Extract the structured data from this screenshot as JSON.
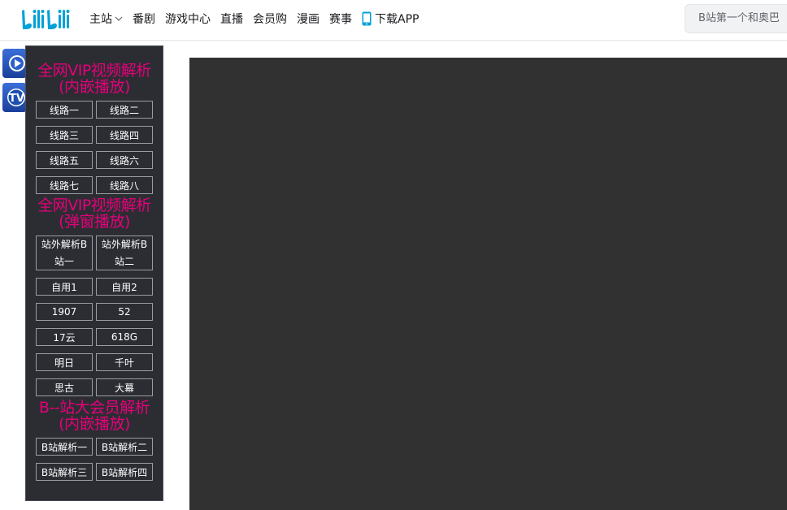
{
  "header": {
    "nav": [
      {
        "label": "主站"
      },
      {
        "label": "番剧"
      },
      {
        "label": "游戏中心"
      },
      {
        "label": "直播"
      },
      {
        "label": "会员购"
      },
      {
        "label": "漫画"
      },
      {
        "label": "赛事"
      },
      {
        "label": "下载APP"
      }
    ],
    "search_placeholder": "B站第一个和奥巴"
  },
  "panel": {
    "sections": [
      {
        "title_line1": "全网VIP视频解析",
        "title_line2": "(内嵌播放)",
        "buttons": [
          "线路一",
          "线路二",
          "线路三",
          "线路四",
          "线路五",
          "线路六",
          "线路七",
          "线路八"
        ]
      },
      {
        "title_line1": "全网VIP视频解析",
        "title_line2": "(弹窗播放)",
        "buttons": [
          "站外解析B站一",
          "站外解析B站二",
          "自用1",
          "自用2",
          "1907",
          "52",
          "17云",
          "618G",
          "明日",
          "千叶",
          "思古",
          "大幕"
        ]
      },
      {
        "title_line1": "B--站大会员解析",
        "title_line2": "(内嵌播放)",
        "buttons": [
          "B站解析一",
          "B站解析二",
          "B站解析三",
          "B站解析四"
        ]
      }
    ]
  },
  "colors": {
    "accent": "#e6007a",
    "brand": "#00a1d6",
    "panel_bg": "#2b2d33",
    "player_bg": "#313131"
  }
}
